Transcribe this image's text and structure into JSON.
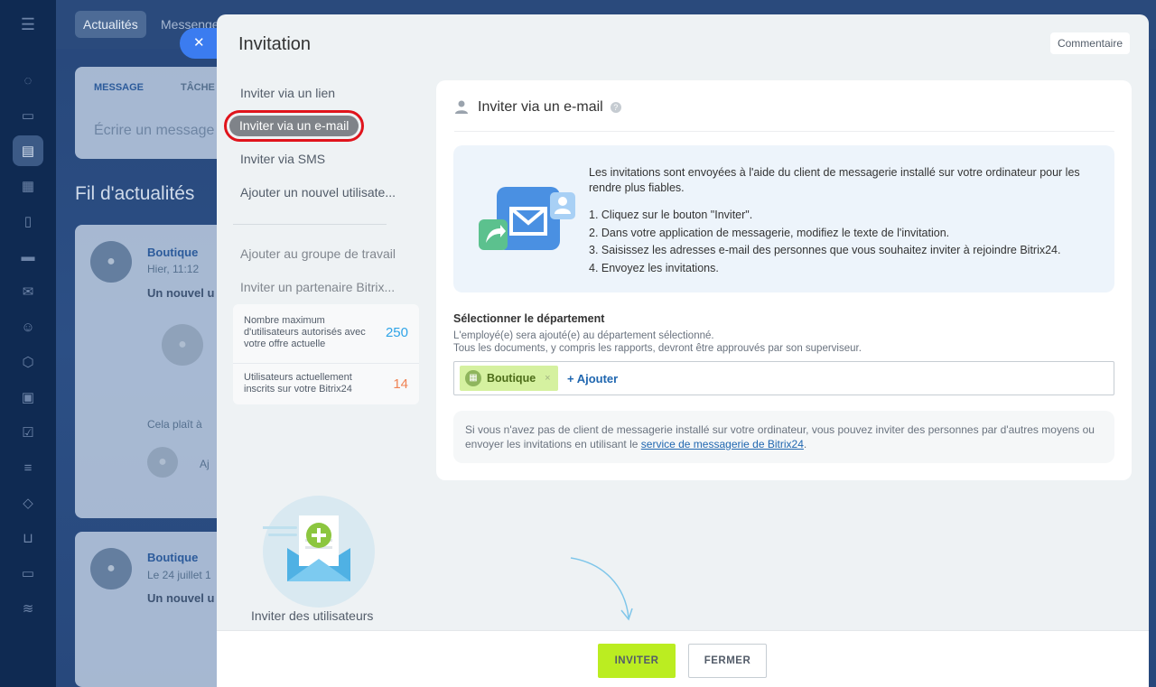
{
  "background": {
    "top_tabs": [
      "Actualités",
      "Messenger"
    ],
    "composer_tabs": [
      "MESSAGE",
      "TÂCHE"
    ],
    "composer_placeholder": "Écrire un message",
    "feed_title": "Fil d'actualités",
    "posts": [
      {
        "author": "Boutique",
        "time": "Hier, 11:12",
        "headline": "Un nouvel u",
        "likes": "Cela plaît à",
        "comment": "Aj"
      },
      {
        "author": "Boutique",
        "time": "Le 24 juillet 1",
        "headline": "Un nouvel u"
      }
    ]
  },
  "slider": {
    "close_icon": "✕",
    "title": "Invitation",
    "comment_button": "Commentaire",
    "menu": {
      "items": [
        "Inviter via un lien",
        "Inviter via un e-mail",
        "Inviter via SMS",
        "Ajouter un nouvel utilisate..."
      ],
      "secondary_items": [
        "Ajouter au groupe de travail",
        "Inviter un partenaire Bitrix..."
      ]
    },
    "limits": {
      "max_label": "Nombre maximum d'utilisateurs autorisés avec votre offre actuelle",
      "max_value": "250",
      "current_label": "Utilisateurs actuellement inscrits sur votre Bitrix24",
      "current_value": "14"
    },
    "promo_caption": "Inviter des utilisateurs",
    "card": {
      "title": "Inviter via un e-mail",
      "help_icon": "?",
      "info_text": "Les invitations sont envoyées à l'aide du client de messagerie installé sur votre ordinateur pour les rendre plus fiables.",
      "steps": [
        "1. Cliquez sur le bouton \"Inviter\".",
        "2. Dans votre application de messagerie, modifiez le texte de l'invitation.",
        "3. Saisissez les adresses e-mail des personnes que vous souhaitez inviter à rejoindre Bitrix24.",
        "4. Envoyez les invitations."
      ],
      "department_title": "Sélectionner le département",
      "department_desc_1": "L'employé(e) sera ajouté(e) au département sélectionné.",
      "department_desc_2": "Tous les documents, y compris les rapports, devront être approuvés par son superviseur.",
      "tag_label": "Boutique",
      "tag_remove": "×",
      "add_label": "+ Ajouter",
      "note_text": "Si vous n'avez pas de client de messagerie installé sur votre ordinateur, vous pouvez inviter des personnes par d'autres moyens ou envoyer les invitations en utilisant le ",
      "note_link": "service de messagerie de Bitrix24",
      "note_end": "."
    },
    "footer": {
      "invite_button": "INVITER",
      "close_button": "FERMER"
    }
  },
  "colors": {
    "accent_green": "#bbed21",
    "link_blue": "#2067b0",
    "highlight_red": "#e0141c",
    "max_value_color": "#2fa4e7",
    "current_value_color": "#f08354"
  }
}
